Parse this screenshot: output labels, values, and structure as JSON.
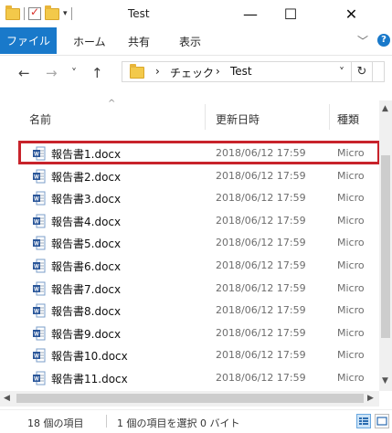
{
  "window": {
    "title": "Test",
    "minimize_glyph": "—",
    "maximize_glyph": "☐",
    "close_glyph": "✕"
  },
  "ribbon": {
    "file_tab": "ファイル",
    "tabs": [
      "ホーム",
      "共有",
      "表示"
    ],
    "collapse_glyph": "﹀",
    "help_glyph": "?"
  },
  "nav": {
    "back_glyph": "←",
    "forward_glyph": "→",
    "recent_glyph": "˅",
    "up_glyph": "↑",
    "crumb_sep": "›",
    "breadcrumb": [
      "チェック",
      "Test"
    ],
    "dropdown_glyph": "˅",
    "refresh_glyph": "↻"
  },
  "columns": {
    "name": "名前",
    "date": "更新日時",
    "type": "種類"
  },
  "files": [
    {
      "name": "報告書1.docx",
      "date": "2018/06/12 17:59",
      "type": "Micro"
    },
    {
      "name": "報告書2.docx",
      "date": "2018/06/12 17:59",
      "type": "Micro"
    },
    {
      "name": "報告書3.docx",
      "date": "2018/06/12 17:59",
      "type": "Micro"
    },
    {
      "name": "報告書4.docx",
      "date": "2018/06/12 17:59",
      "type": "Micro"
    },
    {
      "name": "報告書5.docx",
      "date": "2018/06/12 17:59",
      "type": "Micro"
    },
    {
      "name": "報告書6.docx",
      "date": "2018/06/12 17:59",
      "type": "Micro"
    },
    {
      "name": "報告書7.docx",
      "date": "2018/06/12 17:59",
      "type": "Micro"
    },
    {
      "name": "報告書8.docx",
      "date": "2018/06/12 17:59",
      "type": "Micro"
    },
    {
      "name": "報告書9.docx",
      "date": "2018/06/12 17:59",
      "type": "Micro"
    },
    {
      "name": "報告書10.docx",
      "date": "2018/06/12 17:59",
      "type": "Micro"
    },
    {
      "name": "報告書11.docx",
      "date": "2018/06/12 17:59",
      "type": "Micro"
    }
  ],
  "status": {
    "item_count": "18 個の項目",
    "selection": "1 個の項目を選択 0 バイト"
  },
  "colors": {
    "accent": "#1979ca",
    "highlight_border": "#c8232b",
    "folder": "#f3c94a",
    "word_icon": "#2b579a"
  }
}
